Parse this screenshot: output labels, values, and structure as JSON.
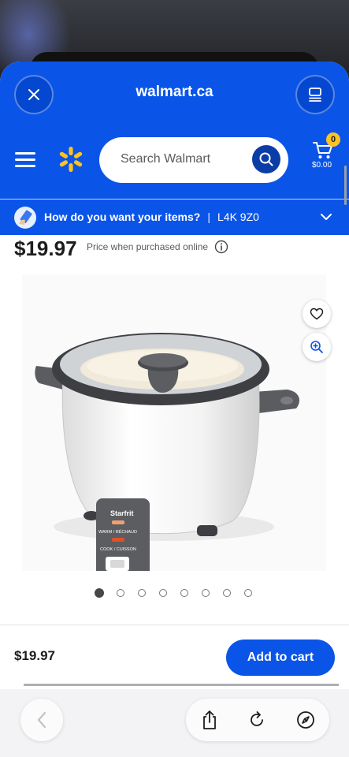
{
  "browser": {
    "domain": "walmart.ca"
  },
  "header": {
    "search_placeholder": "Search Walmart",
    "cart_count": "0",
    "cart_total": "$0.00"
  },
  "delivery": {
    "question": "How do you want your items?",
    "separator": "|",
    "postal_code": "L4K 9Z0"
  },
  "product": {
    "price": "$19.97",
    "price_note": "Price when purchased online",
    "image_brand": "Starfrit",
    "image_label_warm": "WARM / RÉCHAUD",
    "image_label_cook": "COOK / CUISSON",
    "carousel_total": 8,
    "carousel_active": 1
  },
  "footer": {
    "price": "$19.97",
    "add_to_cart": "Add to cart"
  },
  "colors": {
    "walmart_blue": "#0a55e8",
    "spark_yellow": "#ffc220",
    "search_button": "#0a3da8"
  },
  "icons": [
    "close-icon",
    "tabs-icon",
    "menu-icon",
    "walmart-spark-icon",
    "search-icon",
    "cart-icon",
    "delivery-icon",
    "chevron-down-icon",
    "info-icon",
    "heart-icon",
    "zoom-in-icon",
    "back-icon",
    "share-icon",
    "reload-icon",
    "compass-icon"
  ]
}
